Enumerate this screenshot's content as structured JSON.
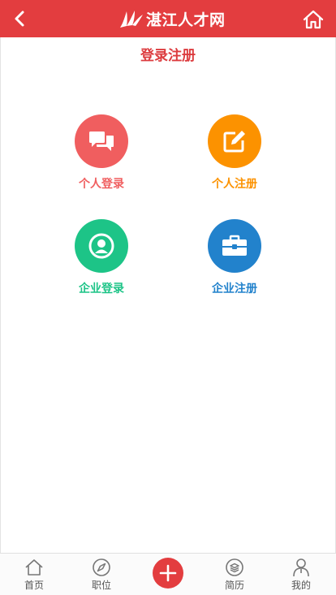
{
  "header": {
    "site_name": "湛江人才网",
    "back_icon": "back-arrow-icon",
    "home_icon": "home-icon",
    "background_color": "#e33d3f"
  },
  "page": {
    "title": "登录注册"
  },
  "options": [
    {
      "label": "个人登录",
      "icon": "chat-bubbles-icon",
      "color": "#f05e5f"
    },
    {
      "label": "个人注册",
      "icon": "edit-icon",
      "color": "#fc9200"
    },
    {
      "label": "企业登录",
      "icon": "user-circle-icon",
      "color": "#1dc487"
    },
    {
      "label": "企业注册",
      "icon": "briefcase-icon",
      "color": "#2282cc"
    }
  ],
  "bottom_nav": {
    "items": [
      {
        "label": "首页",
        "icon": "home-outline-icon"
      },
      {
        "label": "职位",
        "icon": "compass-icon"
      },
      {
        "label": "简历",
        "icon": "layers-icon"
      },
      {
        "label": "我的",
        "icon": "person-icon"
      }
    ],
    "center_button": {
      "icon": "plus-icon",
      "color": "#e33d3f"
    }
  }
}
